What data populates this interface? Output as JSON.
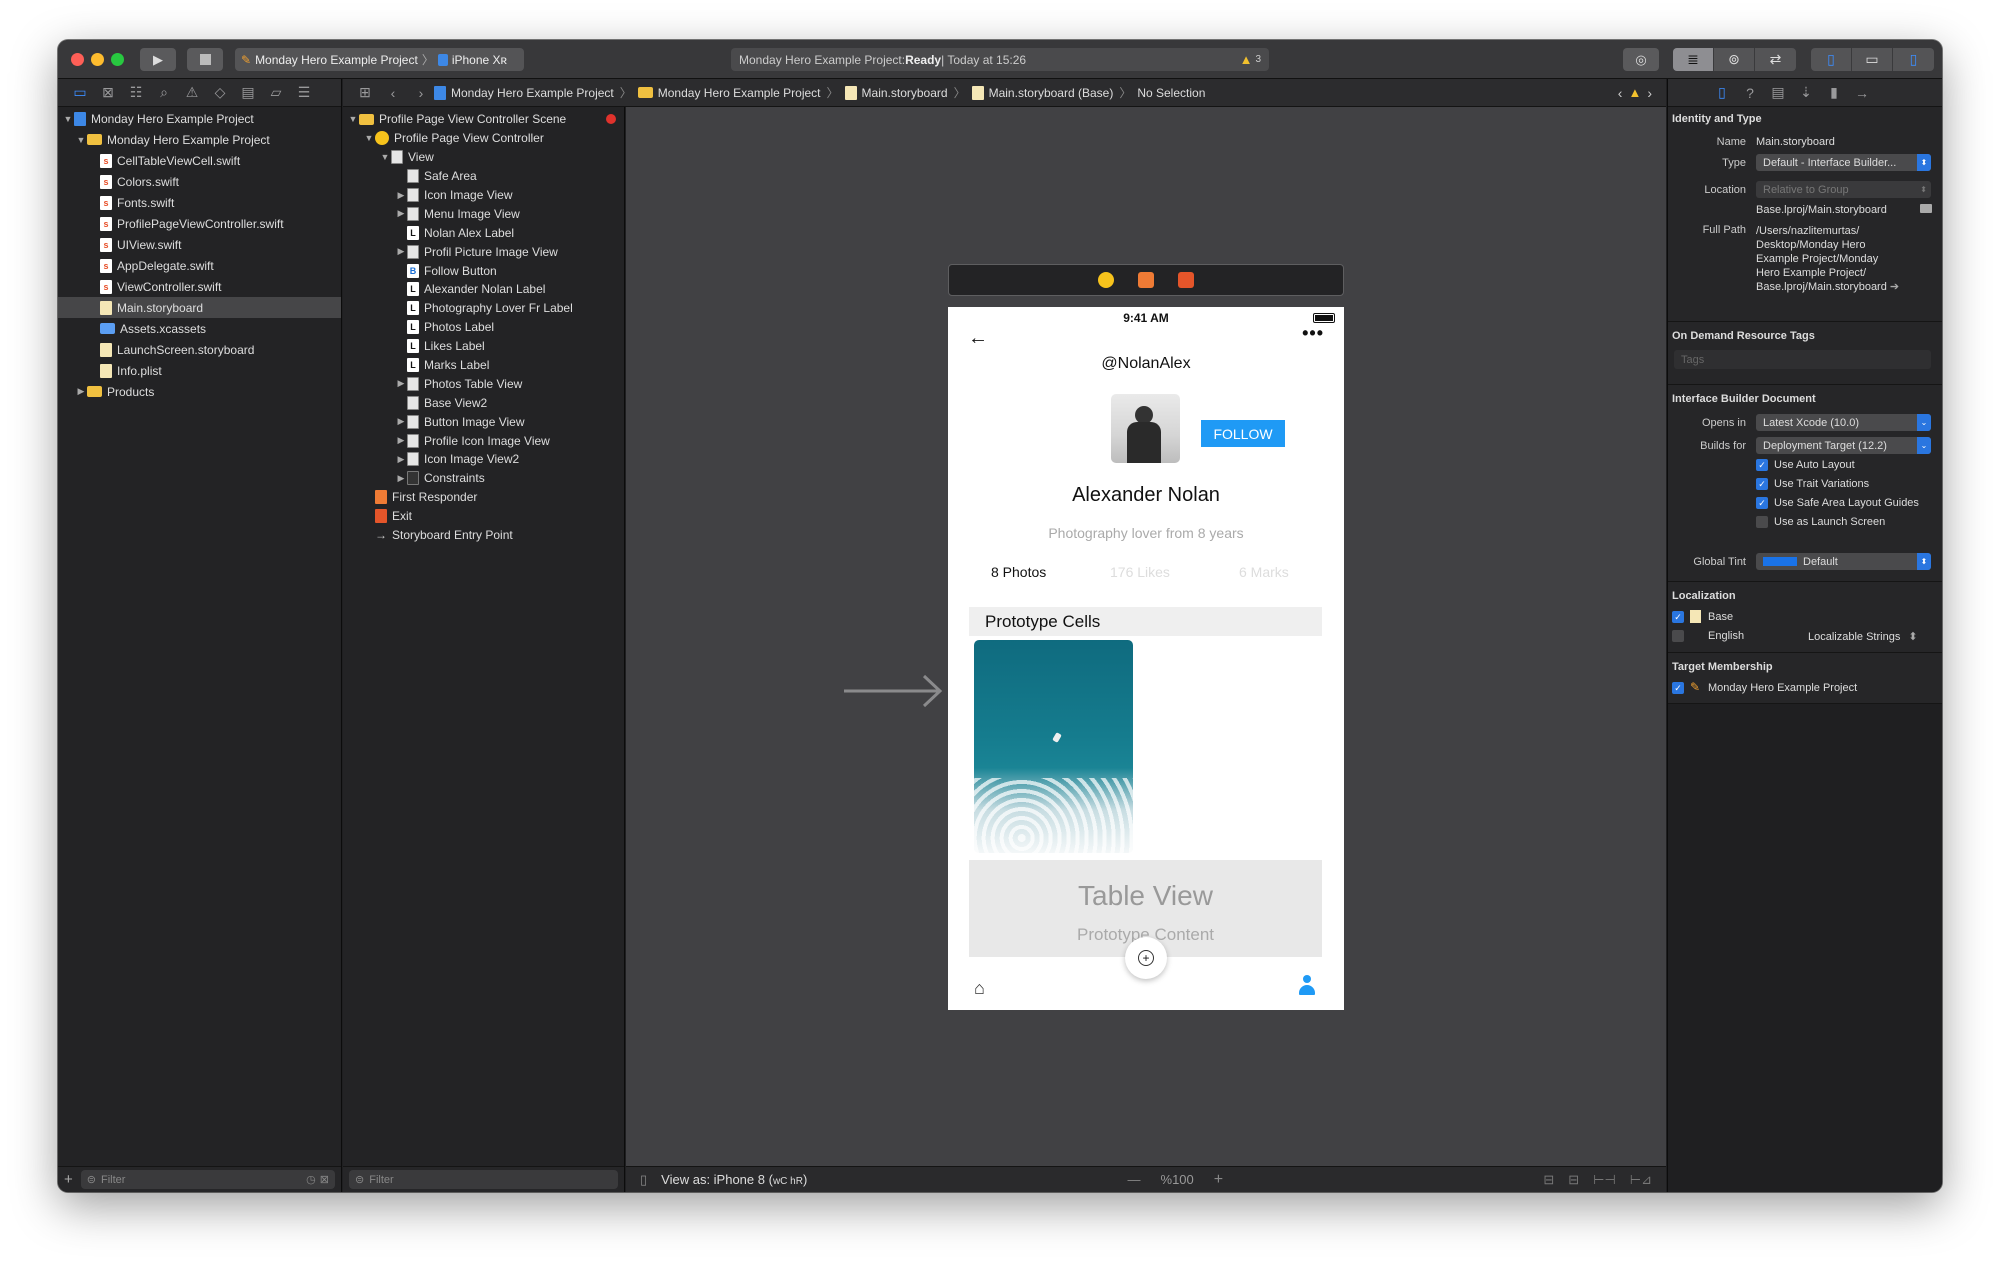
{
  "toolbar": {
    "scheme": "Monday Hero Example Project",
    "device": "iPhone Xʀ",
    "status_prefix": "Monday Hero Example Project: ",
    "status_state": "Ready",
    "status_time": " | Today at 15:26",
    "warning_count": "3"
  },
  "navigator": {
    "items": [
      {
        "label": "Monday Hero Example Project",
        "depth": 0,
        "type": "proj",
        "open": true
      },
      {
        "label": "Monday Hero Example Project",
        "depth": 1,
        "type": "fold",
        "open": true
      },
      {
        "label": "CellTableViewCell.swift",
        "depth": 2,
        "type": "sw"
      },
      {
        "label": "Colors.swift",
        "depth": 2,
        "type": "sw"
      },
      {
        "label": "Fonts.swift",
        "depth": 2,
        "type": "sw"
      },
      {
        "label": "ProfilePageViewController.swift",
        "depth": 2,
        "type": "sw"
      },
      {
        "label": "UIView.swift",
        "depth": 2,
        "type": "sw"
      },
      {
        "label": "AppDelegate.swift",
        "depth": 2,
        "type": "sw"
      },
      {
        "label": "ViewController.swift",
        "depth": 2,
        "type": "sw"
      },
      {
        "label": "Main.storyboard",
        "depth": 2,
        "type": "sb",
        "selected": true
      },
      {
        "label": "Assets.xcassets",
        "depth": 2,
        "type": "folderblue"
      },
      {
        "label": "LaunchScreen.storyboard",
        "depth": 2,
        "type": "sb"
      },
      {
        "label": "Info.plist",
        "depth": 2,
        "type": "sb"
      },
      {
        "label": "Products",
        "depth": 1,
        "type": "fold",
        "open": false
      }
    ],
    "filter_placeholder": "Filter"
  },
  "jumpbar": {
    "crumbs": [
      "Monday Hero Example Project",
      "Monday Hero Example Project",
      "Main.storyboard",
      "Main.storyboard (Base)",
      "No Selection"
    ]
  },
  "outline": {
    "items": [
      {
        "label": "Profile Page View Controller Scene",
        "depth": 0,
        "type": "fold",
        "open": true
      },
      {
        "label": "Profile Page View Controller",
        "depth": 1,
        "type": "vc",
        "open": true
      },
      {
        "label": "View",
        "depth": 2,
        "type": "box",
        "open": true
      },
      {
        "label": "Safe Area",
        "depth": 3,
        "type": "box"
      },
      {
        "label": "Icon Image View",
        "depth": 3,
        "type": "box",
        "closed": true
      },
      {
        "label": "Menu Image View",
        "depth": 3,
        "type": "box",
        "closed": true
      },
      {
        "label": "Nolan Alex Label",
        "depth": 3,
        "type": "L"
      },
      {
        "label": "Profil Picture Image View",
        "depth": 3,
        "type": "box",
        "closed": true
      },
      {
        "label": "Follow Button",
        "depth": 3,
        "type": "B"
      },
      {
        "label": "Alexander Nolan Label",
        "depth": 3,
        "type": "L"
      },
      {
        "label": "Photography Lover Fr Label",
        "depth": 3,
        "type": "L"
      },
      {
        "label": "Photos Label",
        "depth": 3,
        "type": "L"
      },
      {
        "label": "Likes Label",
        "depth": 3,
        "type": "L"
      },
      {
        "label": "Marks Label",
        "depth": 3,
        "type": "L"
      },
      {
        "label": "Photos Table View",
        "depth": 3,
        "type": "box",
        "closed": true
      },
      {
        "label": "Base View2",
        "depth": 3,
        "type": "box"
      },
      {
        "label": "Button Image View",
        "depth": 3,
        "type": "box",
        "closed": true
      },
      {
        "label": "Profile Icon Image View",
        "depth": 3,
        "type": "box",
        "closed": true
      },
      {
        "label": "Icon Image View2",
        "depth": 3,
        "type": "box",
        "closed": true
      },
      {
        "label": "Constraints",
        "depth": 3,
        "type": "cons",
        "closed": true
      },
      {
        "label": "First Responder",
        "depth": 1,
        "type": "resp"
      },
      {
        "label": "Exit",
        "depth": 1,
        "type": "exit"
      },
      {
        "label": "Storyboard Entry Point",
        "depth": 1,
        "type": "arrow"
      }
    ],
    "filter_placeholder": "Filter"
  },
  "phone": {
    "time": "9:41 AM",
    "handle": "@NolanAlex",
    "follow": "FOLLOW",
    "name": "Alexander Nolan",
    "bio": "Photography lover from 8 years",
    "photos": "8 Photos",
    "likes": "176 Likes",
    "marks": "6 Marks",
    "prototype_cells": "Prototype Cells",
    "table_view": "Table View",
    "prototype_content": "Prototype Content"
  },
  "canvas_bottom": {
    "view_as": "View as: iPhone 8 (",
    "size_class": "wC hR",
    "close_paren": ")",
    "zoom": "%100"
  },
  "inspector": {
    "identity_header": "Identity and Type",
    "name_label": "Name",
    "name_value": "Main.storyboard",
    "type_label": "Type",
    "type_value": "Default - Interface Builder...",
    "location_label": "Location",
    "location_value": "Relative to Group",
    "location_file": "Base.lproj/Main.storyboard",
    "fullpath_label": "Full Path",
    "fullpath_lines": [
      "/Users/nazlitemurtas/",
      "Desktop/Monday Hero",
      "Example Project/Monday",
      "Hero Example Project/",
      "Base.lproj/Main.storyboard"
    ],
    "ondemand_header": "On Demand Resource Tags",
    "tags_placeholder": "Tags",
    "ibdoc_header": "Interface Builder Document",
    "opens_in_label": "Opens in",
    "opens_in_value": "Latest Xcode (10.0)",
    "builds_for_label": "Builds for",
    "builds_for_value": "Deployment Target (12.2)",
    "checks": [
      {
        "label": "Use Auto Layout",
        "on": true
      },
      {
        "label": "Use Trait Variations",
        "on": true
      },
      {
        "label": "Use Safe Area Layout Guides",
        "on": true
      },
      {
        "label": "Use as Launch Screen",
        "on": false
      }
    ],
    "tint_label": "Global Tint",
    "tint_value": "Default",
    "localization_header": "Localization",
    "loc_base": "Base",
    "loc_english": "English",
    "loc_strings": "Localizable Strings",
    "target_header": "Target Membership",
    "target_value": "Monday Hero Example Project"
  }
}
